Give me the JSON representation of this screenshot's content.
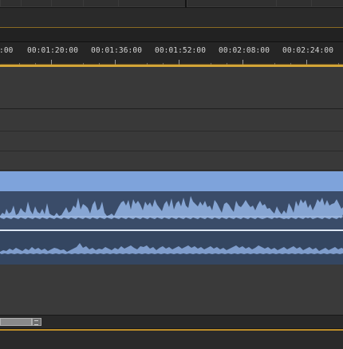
{
  "ruler": {
    "labels": [
      ":00",
      "00:01:20:00",
      "00:01:36:00",
      "00:01:52:00",
      "00:02:08:00",
      "00:02:24:00"
    ]
  },
  "timeline": {
    "playhead_color": "#d3a537",
    "clip_header_color": "#7ea3db",
    "waveform_color": "#87a6d4",
    "waveform_background": "#3a4c69"
  },
  "icons": {
    "scroll_grip": "grip-lines-icon"
  }
}
